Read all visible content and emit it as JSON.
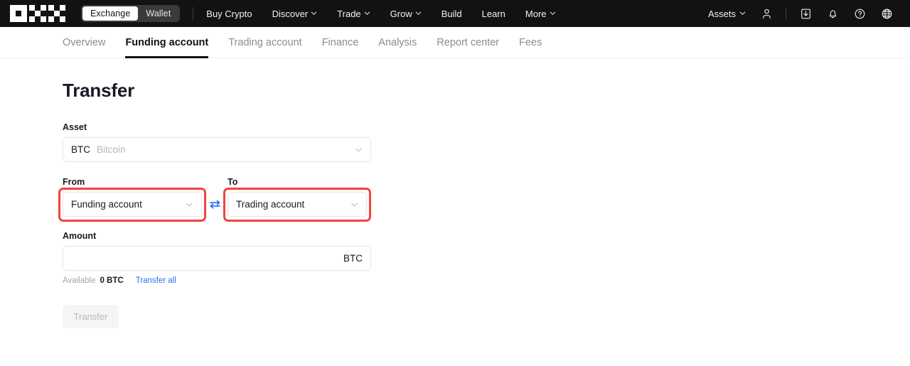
{
  "header": {
    "logo_name": "okx-logo",
    "segmented": {
      "items": [
        {
          "label": "Exchange",
          "active": true
        },
        {
          "label": "Wallet",
          "active": false
        }
      ]
    },
    "nav": [
      {
        "label": "Buy Crypto",
        "caret": false
      },
      {
        "label": "Discover",
        "caret": true
      },
      {
        "label": "Trade",
        "caret": true
      },
      {
        "label": "Grow",
        "caret": true
      },
      {
        "label": "Build",
        "caret": false
      },
      {
        "label": "Learn",
        "caret": false
      },
      {
        "label": "More",
        "caret": true
      }
    ],
    "assets_label": "Assets",
    "icons": [
      "user-icon",
      "download-icon",
      "bell-icon",
      "help-icon",
      "globe-icon"
    ],
    "background": "#121212"
  },
  "subnav": {
    "tabs": [
      {
        "label": "Overview",
        "active": false
      },
      {
        "label": "Funding account",
        "active": true
      },
      {
        "label": "Trading account",
        "active": false
      },
      {
        "label": "Finance",
        "active": false
      },
      {
        "label": "Analysis",
        "active": false
      },
      {
        "label": "Report center",
        "active": false
      },
      {
        "label": "Fees",
        "active": false
      }
    ]
  },
  "main": {
    "title": "Transfer",
    "asset": {
      "label": "Asset",
      "symbol": "BTC",
      "name": "Bitcoin"
    },
    "from": {
      "label": "From",
      "value": "Funding account",
      "highlighted": true
    },
    "to": {
      "label": "To",
      "value": "Trading account",
      "highlighted": true
    },
    "swap_icon": "swap-arrows-icon",
    "amount": {
      "label": "Amount",
      "value": "",
      "placeholder": "",
      "suffix": "BTC"
    },
    "available": {
      "label": "Available",
      "value": "0 BTC",
      "transfer_all_label": "Transfer all"
    },
    "submit": {
      "label": "Transfer",
      "disabled": true
    }
  },
  "colors": {
    "highlight_red": "#f2443b",
    "link_blue": "#2a6ef0",
    "swap_blue": "#1b6ef5",
    "header_bg": "#121212"
  }
}
